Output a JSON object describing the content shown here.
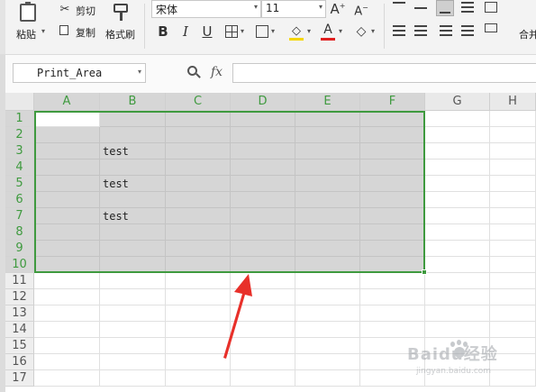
{
  "ribbon": {
    "paste_label": "粘贴",
    "cut_label": "剪切",
    "copy_label": "复制",
    "format_painter_label": "格式刷",
    "font_name": "宋体",
    "font_size": "11",
    "merge_label": "合并"
  },
  "formula_bar": {
    "name_box": "Print_Area",
    "fx_label": "fx",
    "formula_value": ""
  },
  "sheet": {
    "columns": [
      "A",
      "B",
      "C",
      "D",
      "E",
      "F",
      "G",
      "H"
    ],
    "rows": [
      "1",
      "2",
      "3",
      "4",
      "5",
      "6",
      "7",
      "8",
      "9",
      "10",
      "11",
      "12",
      "13",
      "14",
      "15",
      "16",
      "17"
    ],
    "cells": {
      "B3": "test",
      "B5": "test",
      "B7": "test"
    }
  },
  "watermark": {
    "brand": "Baidu经验",
    "url": "jingyan.baidu.com"
  },
  "colors": {
    "selection_border": "#3f9a3f",
    "selection_fill": "#d6d6d6",
    "arrow": "#e8302a",
    "font_color_bar": "#e02020",
    "fill_color_bar": "#f5d600"
  }
}
